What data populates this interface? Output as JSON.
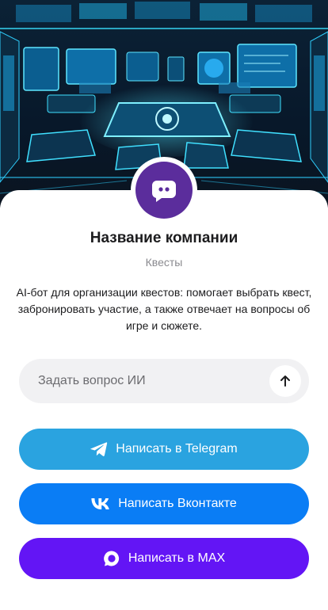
{
  "company": {
    "name": "Название компании",
    "category": "Квесты",
    "description": "AI-бот для организации квестов: помогает выбрать квест, забронировать участие, а также отвечает на вопросы об игре и сюжете."
  },
  "ask": {
    "placeholder": "Задать вопрос ИИ"
  },
  "actions": {
    "telegram": {
      "label": "Написать в Telegram",
      "color": "#2aa3e0",
      "icon": "telegram-icon"
    },
    "vk": {
      "label": "Написать Вконтакте",
      "color": "#0a7df5",
      "icon": "vk-icon"
    },
    "max": {
      "label": "Написать в MAX",
      "color": "#6315f5",
      "icon": "max-icon"
    }
  },
  "colors": {
    "avatar": "#5b2d9c",
    "hero_glow": "#19d4ff"
  }
}
